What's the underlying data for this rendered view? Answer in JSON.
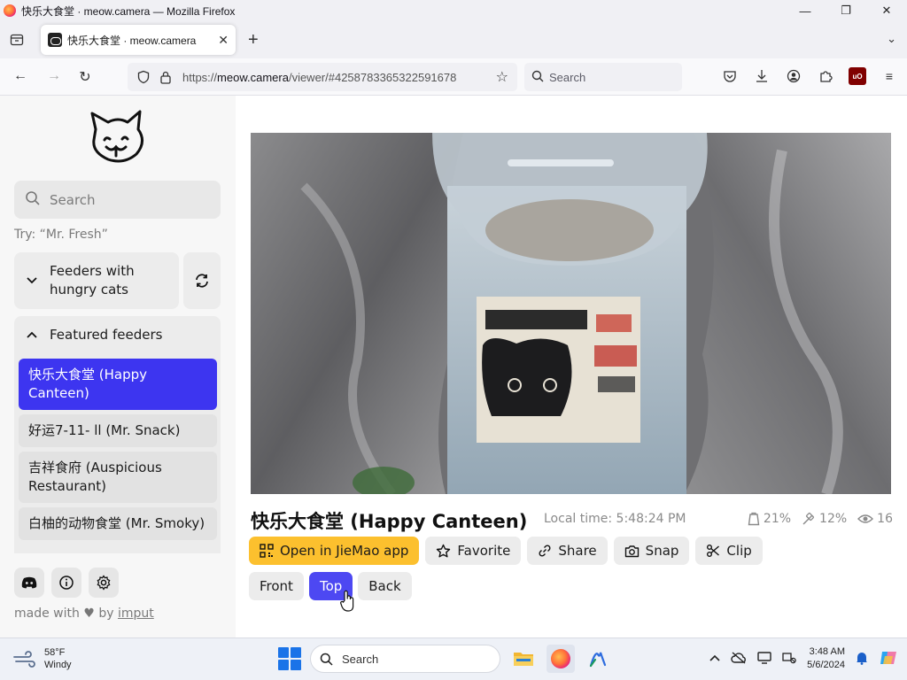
{
  "window": {
    "title": "快乐大食堂 · meow.camera — Mozilla Firefox",
    "controls": {
      "minimize": "—",
      "maximize": "❐",
      "close": "✕"
    }
  },
  "tabs": [
    {
      "title": "快乐大食堂 · meow.camera",
      "active": true
    }
  ],
  "nav": {
    "url_prefix": "https://",
    "url_host": "meow.camera",
    "url_path": "/viewer/#4258783365322591678",
    "search_placeholder": "Search"
  },
  "sidebar": {
    "search_placeholder": "Search",
    "hint": "Try: “Mr. Fresh”",
    "group_hungry_label": "Feeders with hungry cats",
    "group_featured_label": "Featured feeders",
    "feeders": [
      {
        "name": "快乐大食堂 (Happy Canteen)",
        "active": true
      },
      {
        "name": "好运7-11- ll  (Mr. Snack)",
        "active": false
      },
      {
        "name": "吉祥食府 (Auspicious Restaurant)",
        "active": false
      },
      {
        "name": "白柚的动物食堂 (Mr. Smoky)",
        "active": false
      }
    ],
    "made_with_prefix": "made with",
    "made_with_by": "by",
    "made_with_author": "imput"
  },
  "main": {
    "camera_title": "快乐大食堂 (Happy Canteen)",
    "local_time": "Local time: 5:48:24 PM",
    "stats": {
      "food": "21%",
      "battery": "12%",
      "viewers": "16"
    },
    "actions": {
      "open_app": "Open in JieMao app",
      "favorite": "Favorite",
      "share": "Share",
      "snap": "Snap",
      "clip": "Clip"
    },
    "views": [
      {
        "label": "Front",
        "selected": false
      },
      {
        "label": "Top",
        "selected": true
      },
      {
        "label": "Back",
        "selected": false
      }
    ]
  },
  "taskbar": {
    "weather_temp": "58°F",
    "weather_desc": "Windy",
    "search_placeholder": "Search",
    "time": "3:48 AM",
    "date": "5/6/2024"
  },
  "colors": {
    "accent": "#4d48f2",
    "active_feeder": "#3d35f0",
    "primary_button": "#fcc02e"
  }
}
